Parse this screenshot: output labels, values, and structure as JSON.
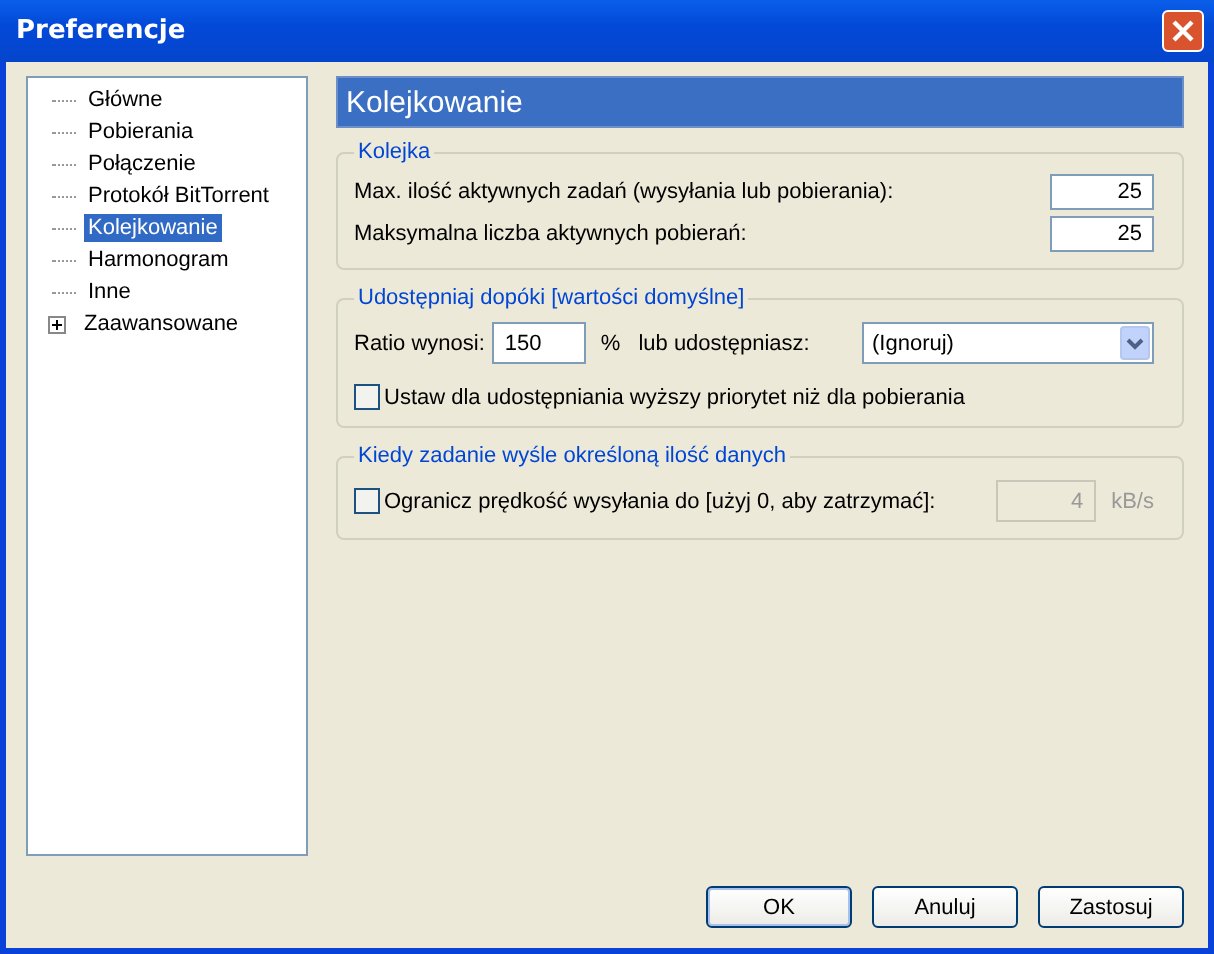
{
  "window": {
    "title": "Preferencje"
  },
  "sidebar": {
    "items": [
      {
        "label": "Główne",
        "selected": false
      },
      {
        "label": "Pobierania",
        "selected": false
      },
      {
        "label": "Połączenie",
        "selected": false
      },
      {
        "label": "Protokół BitTorrent",
        "selected": false
      },
      {
        "label": "Kolejkowanie",
        "selected": true
      },
      {
        "label": "Harmonogram",
        "selected": false
      },
      {
        "label": "Inne",
        "selected": false
      },
      {
        "label": "Zaawansowane",
        "selected": false,
        "expanded": false
      }
    ]
  },
  "page": {
    "title": "Kolejkowanie",
    "queue": {
      "title": "Kolejka",
      "rows": [
        {
          "label": "Max. ilość aktywnych zadań (wysyłania lub pobierania):",
          "value": "25"
        },
        {
          "label": "Maksymalna liczba aktywnych pobierań:",
          "value": "25"
        }
      ]
    },
    "share": {
      "title": "Udostępniaj dopóki [wartości domyślne]",
      "ratio_label": "Ratio wynosi:",
      "ratio_value": "150",
      "percent": "%",
      "or_label": "lub udostępniasz:",
      "dropdown_value": "(Ignoruj)",
      "priority_checkbox": {
        "label": "Ustaw dla udostępniania wyższy priorytet niż dla pobierania",
        "checked": false
      }
    },
    "limit": {
      "title": "Kiedy zadanie wyśle określoną ilość danych",
      "checkbox": {
        "label": "Ogranicz prędkość wysyłania do [użyj 0, aby zatrzymać]:",
        "checked": false
      },
      "value": "4",
      "disabled": true,
      "unit": "kB/s"
    }
  },
  "buttons": [
    "OK",
    "Anuluj",
    "Zastosuj"
  ]
}
